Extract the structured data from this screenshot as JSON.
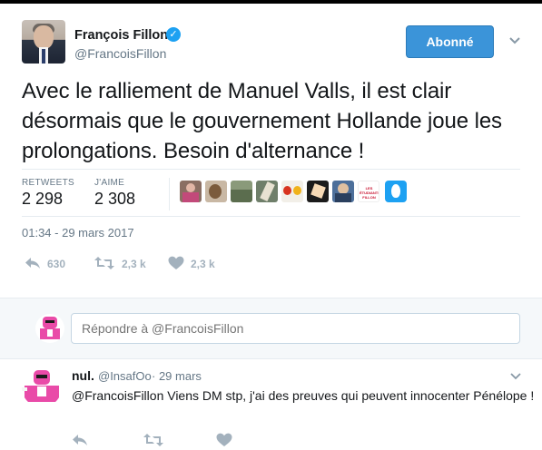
{
  "tweet": {
    "author_name": "François Fillon",
    "author_handle": "@FrancoisFillon",
    "follow_label": "Abonné",
    "text": "Avec le ralliement de Manuel Valls, il est clair désormais que le gouvernement Hollande joue les prolongations. Besoin d'alternance !",
    "stats": {
      "retweets_label": "RETWEETS",
      "retweets_value": "2 298",
      "likes_label": "J'AIME",
      "likes_value": "2 308"
    },
    "liker_badge_text": "LES ÉTUDIANTS FILLON",
    "timestamp": "01:34 - 29 mars 2017",
    "actions": {
      "reply_count": "630",
      "retweet_count": "2,3 k",
      "like_count": "2,3 k"
    }
  },
  "reply_box": {
    "placeholder": "Répondre à @FrancoisFillon"
  },
  "comment": {
    "name": "nul.",
    "handle": "@InsafOo",
    "time": "· 29 mars",
    "text": "@FrancoisFillon Viens DM stp, j'ai des preuves qui peuvent innocenter Pénélope !"
  },
  "colors": {
    "accent": "#1da1f2",
    "follow_button": "#3b94d9",
    "muted_text": "#657786",
    "action_icon": "#a3b1bd",
    "reply_band": "#f5f8fa"
  }
}
